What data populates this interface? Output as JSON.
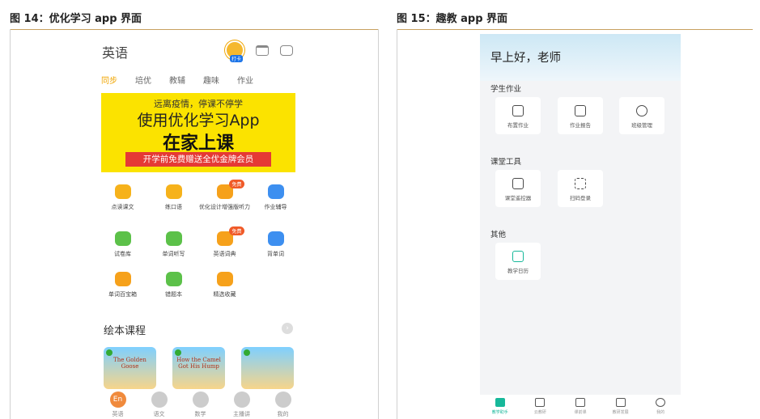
{
  "figures": {
    "left_title": "图 14：优化学习 app 界面",
    "right_title": "图 15：趣教 app 界面"
  },
  "app1": {
    "title": "英语",
    "mascot_badge": "打卡",
    "tabs": [
      "同步",
      "培优",
      "教辅",
      "趣味",
      "作业"
    ],
    "banner": {
      "line1": "远离疫情，停课不停学",
      "line2": "使用优化学习App",
      "line3": "在家上课",
      "line4": "开学前免费赠送全优金牌会员"
    },
    "grid_rows": [
      [
        {
          "label": "点读课文",
          "icon": "book-icon",
          "color": "#f6b21b",
          "badge": ""
        },
        {
          "label": "练口语",
          "icon": "chat-icon",
          "color": "#f6b21b",
          "badge": ""
        },
        {
          "label": "优化设计增强版听力",
          "icon": "headphone-icon",
          "color": "#f6a11b",
          "badge": "免费"
        },
        {
          "label": "作业辅导",
          "icon": "homework-icon",
          "color": "#3d8ff0",
          "badge": ""
        }
      ],
      [
        {
          "label": "试卷库",
          "icon": "paper-icon",
          "color": "#5cc149",
          "badge": ""
        },
        {
          "label": "单词听写",
          "icon": "game-icon",
          "color": "#5cc149",
          "badge": ""
        },
        {
          "label": "英语词典",
          "icon": "dictionary-icon",
          "color": "#f6a11b",
          "badge": "免费"
        },
        {
          "label": "背单词",
          "icon": "word-icon",
          "color": "#3d8ff0",
          "badge": ""
        }
      ],
      [
        {
          "label": "单词百宝箱",
          "icon": "toolbox-icon",
          "color": "#f6a11b",
          "badge": ""
        },
        {
          "label": "错题本",
          "icon": "mistake-book-icon",
          "color": "#5cc149",
          "badge": ""
        },
        {
          "label": "精选收藏",
          "icon": "star-icon",
          "color": "#f6a11b",
          "badge": ""
        }
      ]
    ],
    "section_title": "绘本课程",
    "books": [
      {
        "title": "The Golden Goose"
      },
      {
        "title": "How the Camel Got His Hump"
      },
      {
        "title": ""
      }
    ],
    "bottom_tabs": [
      {
        "label": "英语",
        "icon_text": "En"
      },
      {
        "label": "语文",
        "icon_text": ""
      },
      {
        "label": "数学",
        "icon_text": ""
      },
      {
        "label": "主播讲",
        "icon_text": ""
      },
      {
        "label": "我的",
        "icon_text": ""
      }
    ]
  },
  "app2": {
    "greeting": "早上好，老师",
    "sections": [
      {
        "title": "学生作业",
        "cards": [
          "布置作业",
          "作业报告",
          "班级管理"
        ]
      },
      {
        "title": "课堂工具",
        "cards": [
          "课堂遥控器",
          "扫码登录"
        ]
      },
      {
        "title": "其他",
        "cards": [
          "教学日历"
        ]
      }
    ],
    "bottom_tabs": [
      "教学助手",
      "云教研",
      "课前课",
      "教研发展",
      "我的"
    ]
  },
  "colors": {
    "accent_orange": "#f0a500",
    "banner_yellow": "#fbe300",
    "banner_red": "#e53935",
    "teal": "#17b89a"
  }
}
